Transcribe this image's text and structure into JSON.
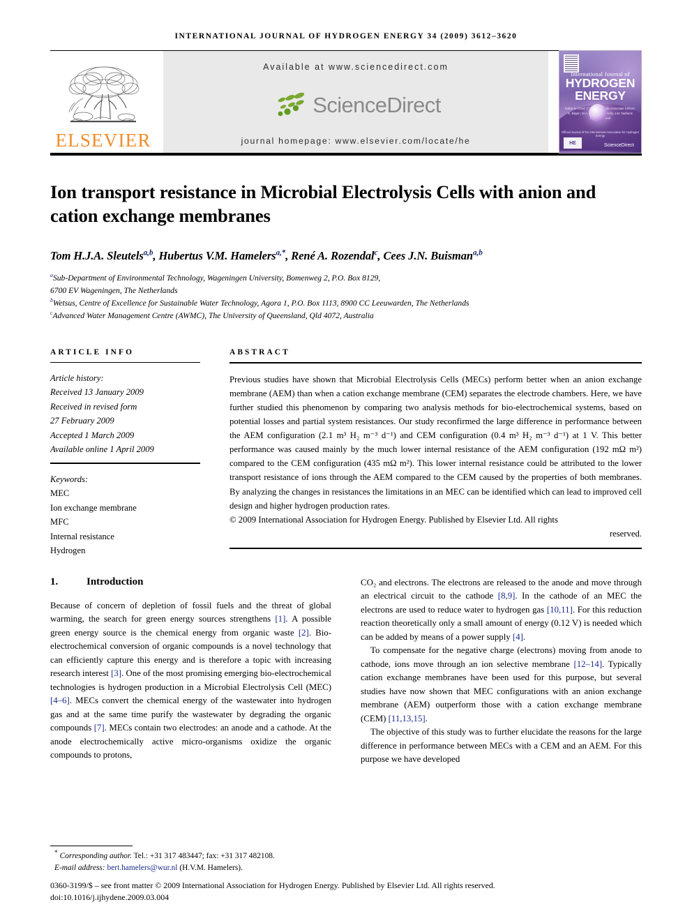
{
  "running_head": "INTERNATIONAL JOURNAL OF HYDROGEN ENERGY 34 (2009) 3612–3620",
  "masthead": {
    "publisher_name": "ELSEVIER",
    "publisher_color": "#F28C28",
    "available_at": "Available at www.sciencedirect.com",
    "sciencedirect_wordmark": "ScienceDirect",
    "journal_homepage": "journal homepage: www.elsevier.com/locate/he",
    "cover": {
      "line1": "International Journal of",
      "line2": "HYDROGEN",
      "line3": "ENERGY",
      "editors": "Editor-in-Chief: T. Nejat Veziroğlu\nAssociate Editors: E. Bilgen, M.A. Rosen, N.A. Kelly, J.M. Norbeck and S.A. Sherif",
      "issn_note": "Official Journal of the International Association for Hydrogen Energy",
      "sciencedirect_badge": "ScienceDirect",
      "badge": "HE"
    }
  },
  "article": {
    "title": "Ion transport resistance in Microbial Electrolysis Cells with anion and cation exchange membranes",
    "authors": [
      {
        "name": "Tom H.J.A. Sleutels",
        "sup": "a,b",
        "sep": ", "
      },
      {
        "name": "Hubertus V.M. Hamelers",
        "sup": "a,*",
        "sep": ", "
      },
      {
        "name": "René A. Rozendal",
        "sup": "c",
        "sep": ", "
      },
      {
        "name": "Cees J.N. Buisman",
        "sup": "a,b",
        "sep": ""
      }
    ],
    "affiliations": [
      {
        "sup": "a",
        "text": "Sub-Department of Environmental Technology, Wageningen University, Bomenweg 2, P.O. Box 8129,"
      },
      {
        "sup": "",
        "text": "6700 EV Wageningen, The Netherlands"
      },
      {
        "sup": "b",
        "text": "Wetsus, Centre of Excellence for Sustainable Water Technology, Agora 1, P.O. Box 1113, 8900 CC Leeuwarden, The Netherlands"
      },
      {
        "sup": "c",
        "text": "Advanced Water Management Centre (AWMC), The University of Queensland, Qld 4072, Australia"
      }
    ]
  },
  "article_info": {
    "label": "ARTICLE INFO",
    "history_title": "Article history:",
    "history": [
      "Received 13 January 2009",
      "Received in revised form",
      "27 February 2009",
      "Accepted 1 March 2009",
      "Available online 1 April 2009"
    ],
    "keywords_title": "Keywords:",
    "keywords": [
      "MEC",
      "Ion exchange membrane",
      "MFC",
      "Internal resistance",
      "Hydrogen"
    ]
  },
  "abstract": {
    "label": "ABSTRACT",
    "text": "Previous studies have shown that Microbial Electrolysis Cells (MECs) perform better when an anion exchange membrane (AEM) than when a cation exchange membrane (CEM) separates the electrode chambers. Here, we have further studied this phenomenon by comparing two analysis methods for bio-electrochemical systems, based on potential losses and partial system resistances. Our study reconfirmed the large difference in performance between the AEM configuration (2.1 m³ H₂ m⁻³ d⁻¹) and CEM configuration (0.4 m³ H₂ m⁻³ d⁻¹) at 1 V. This better performance was caused mainly by the much lower internal resistance of the AEM configuration (192 mΩ m²) compared to the CEM configuration (435 mΩ m²). This lower internal resistance could be attributed to the lower transport resistance of ions through the AEM compared to the CEM caused by the properties of both membranes. By analyzing the changes in resistances the limitations in an MEC can be identified which can lead to improved cell design and higher hydrogen production rates.",
    "copyright": "© 2009 International Association for Hydrogen Energy. Published by Elsevier Ltd. All rights",
    "reserved": "reserved."
  },
  "introduction": {
    "number": "1.",
    "heading": "Introduction",
    "left_paragraph_1": "Because of concern of depletion of fossil fuels and the threat of global warming, the search for green energy sources strengthens [1]. A possible green energy source is the chemical energy from organic waste [2]. Bio-electrochemical conversion of organic compounds is a novel technology that can efficiently capture this energy and is therefore a topic with increasing research interest [3]. One of the most promising emerging bio-electrochemical technologies is hydrogen production in a Microbial Electrolysis Cell (MEC) [4–6]. MECs convert the chemical energy of the wastewater into hydrogen gas and at the same time purify the wastewater by degrading the organic compounds [7]. MECs contain two electrodes: an anode and a cathode. At the anode electrochemically active micro-organisms oxidize the organic compounds to protons,",
    "right_paragraph_1": "CO₂ and electrons. The electrons are released to the anode and move through an electrical circuit to the cathode [8,9]. In the cathode of an MEC the electrons are used to reduce water to hydrogen gas [10,11]. For this reduction reaction theoretically only a small amount of energy (0.12 V) is needed which can be added by means of a power supply [4].",
    "right_paragraph_2": "To compensate for the negative charge (electrons) moving from anode to cathode, ions move through an ion selective membrane [12–14]. Typically cation exchange membranes have been used for this purpose, but several studies have now shown that MEC configurations with an anion exchange membrane (AEM) outperform those with a cation exchange membrane (CEM) [11,13,15].",
    "right_paragraph_3": "The objective of this study was to further elucidate the reasons for the large difference in performance between MECs with a CEM and an AEM. For this purpose we have developed"
  },
  "footnotes": {
    "corresponding_marker": "*",
    "corresponding_label": "Corresponding author.",
    "corresponding_contact": " Tel.: +31 317 483447; fax: +31 317 482108.",
    "email_label": "E-mail address:",
    "email": "bert.hamelers@wur.nl",
    "email_owner": "(H.V.M. Hamelers).",
    "imprint_line": "0360-3199/$ – see front matter © 2009 International Association for Hydrogen Energy. Published by Elsevier Ltd. All rights reserved.",
    "doi_line": "doi:10.1016/j.ijhydene.2009.03.004"
  },
  "colors": {
    "citation_blue": "#1a2a8c",
    "elsevier_orange": "#F28C28",
    "sciencedirect_grey": "#8a8a8a",
    "band_background": "#e9e9e9"
  }
}
